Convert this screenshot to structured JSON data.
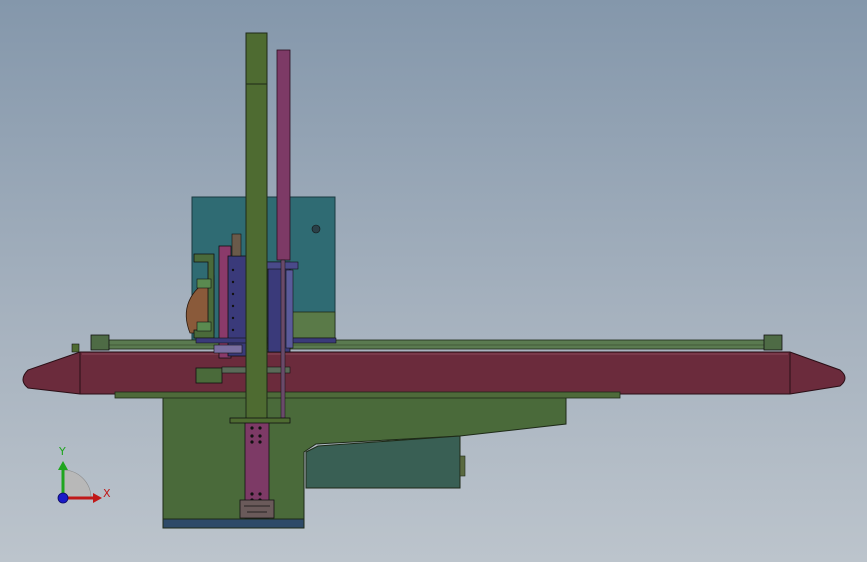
{
  "triad": {
    "y_label": "Y",
    "x_label": "X",
    "y_color": "#1fa51f",
    "x_color": "#c01818",
    "z_color": "#1a1ac8"
  },
  "palette": {
    "pillar": "#4e6b31",
    "rod": "#7d3a66",
    "rail": "#6b2b3c",
    "housing": "#2f6b73",
    "base": "#4a6a3a",
    "panel": "#395f54",
    "carriage": "#3a3a7a",
    "strip": "#7a6fa0",
    "shoe": "#8a5a3a"
  }
}
